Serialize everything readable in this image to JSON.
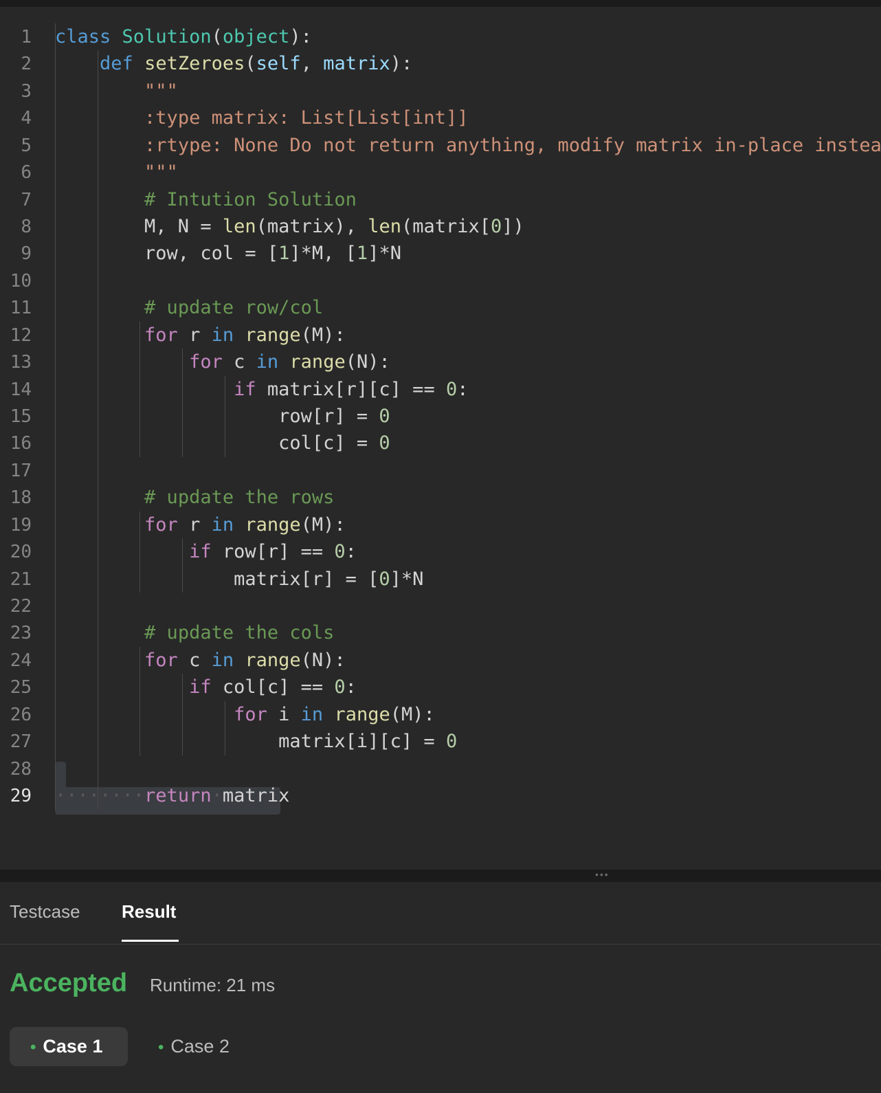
{
  "editor": {
    "lines": [
      {
        "n": "1",
        "tokens": [
          {
            "t": "class",
            "c": "kb"
          },
          {
            "t": " "
          },
          {
            "t": "Solution",
            "c": "cls"
          },
          {
            "t": "("
          },
          {
            "t": "object",
            "c": "cls"
          },
          {
            "t": "):"
          }
        ]
      },
      {
        "n": "2",
        "tokens": [
          {
            "t": "    "
          },
          {
            "t": "def",
            "c": "kb"
          },
          {
            "t": " "
          },
          {
            "t": "setZeroes",
            "c": "fn"
          },
          {
            "t": "("
          },
          {
            "t": "self",
            "c": "prm"
          },
          {
            "t": ", "
          },
          {
            "t": "matrix",
            "c": "prm"
          },
          {
            "t": "):"
          }
        ]
      },
      {
        "n": "3",
        "tokens": [
          {
            "t": "        "
          },
          {
            "t": "\"\"\"",
            "c": "str"
          }
        ]
      },
      {
        "n": "4",
        "tokens": [
          {
            "t": "        "
          },
          {
            "t": ":type matrix: List[List[int]]",
            "c": "str"
          }
        ]
      },
      {
        "n": "5",
        "tokens": [
          {
            "t": "        "
          },
          {
            "t": ":rtype: None Do not return anything, modify matrix in-place instead.",
            "c": "str"
          }
        ]
      },
      {
        "n": "6",
        "tokens": [
          {
            "t": "        "
          },
          {
            "t": "\"\"\"",
            "c": "str"
          }
        ]
      },
      {
        "n": "7",
        "tokens": [
          {
            "t": "        "
          },
          {
            "t": "# Intution Solution",
            "c": "cm"
          }
        ]
      },
      {
        "n": "8",
        "tokens": [
          {
            "t": "        M, N = "
          },
          {
            "t": "len",
            "c": "fn"
          },
          {
            "t": "(matrix), "
          },
          {
            "t": "len",
            "c": "fn"
          },
          {
            "t": "(matrix["
          },
          {
            "t": "0",
            "c": "num"
          },
          {
            "t": "])"
          }
        ]
      },
      {
        "n": "9",
        "tokens": [
          {
            "t": "        row, col = ["
          },
          {
            "t": "1",
            "c": "num"
          },
          {
            "t": "]*M, ["
          },
          {
            "t": "1",
            "c": "num"
          },
          {
            "t": "]*N"
          }
        ]
      },
      {
        "n": "10",
        "tokens": []
      },
      {
        "n": "11",
        "tokens": [
          {
            "t": "        "
          },
          {
            "t": "# update row/col",
            "c": "cm"
          }
        ]
      },
      {
        "n": "12",
        "tokens": [
          {
            "t": "        "
          },
          {
            "t": "for",
            "c": "kw"
          },
          {
            "t": " r "
          },
          {
            "t": "in",
            "c": "kb"
          },
          {
            "t": " "
          },
          {
            "t": "range",
            "c": "fn"
          },
          {
            "t": "(M):"
          }
        ]
      },
      {
        "n": "13",
        "tokens": [
          {
            "t": "            "
          },
          {
            "t": "for",
            "c": "kw"
          },
          {
            "t": " c "
          },
          {
            "t": "in",
            "c": "kb"
          },
          {
            "t": " "
          },
          {
            "t": "range",
            "c": "fn"
          },
          {
            "t": "(N):"
          }
        ]
      },
      {
        "n": "14",
        "tokens": [
          {
            "t": "                "
          },
          {
            "t": "if",
            "c": "kw"
          },
          {
            "t": " matrix[r][c] == "
          },
          {
            "t": "0",
            "c": "num"
          },
          {
            "t": ":"
          }
        ]
      },
      {
        "n": "15",
        "tokens": [
          {
            "t": "                    row[r] = "
          },
          {
            "t": "0",
            "c": "num"
          }
        ]
      },
      {
        "n": "16",
        "tokens": [
          {
            "t": "                    col[c] = "
          },
          {
            "t": "0",
            "c": "num"
          }
        ]
      },
      {
        "n": "17",
        "tokens": []
      },
      {
        "n": "18",
        "tokens": [
          {
            "t": "        "
          },
          {
            "t": "# update the rows",
            "c": "cm"
          }
        ]
      },
      {
        "n": "19",
        "tokens": [
          {
            "t": "        "
          },
          {
            "t": "for",
            "c": "kw"
          },
          {
            "t": " r "
          },
          {
            "t": "in",
            "c": "kb"
          },
          {
            "t": " "
          },
          {
            "t": "range",
            "c": "fn"
          },
          {
            "t": "(M):"
          }
        ]
      },
      {
        "n": "20",
        "tokens": [
          {
            "t": "            "
          },
          {
            "t": "if",
            "c": "kw"
          },
          {
            "t": " row[r] == "
          },
          {
            "t": "0",
            "c": "num"
          },
          {
            "t": ":"
          }
        ]
      },
      {
        "n": "21",
        "tokens": [
          {
            "t": "                matrix[r] = ["
          },
          {
            "t": "0",
            "c": "num"
          },
          {
            "t": "]*N"
          }
        ]
      },
      {
        "n": "22",
        "tokens": []
      },
      {
        "n": "23",
        "tokens": [
          {
            "t": "        "
          },
          {
            "t": "# update the cols",
            "c": "cm"
          }
        ]
      },
      {
        "n": "24",
        "tokens": [
          {
            "t": "        "
          },
          {
            "t": "for",
            "c": "kw"
          },
          {
            "t": " c "
          },
          {
            "t": "in",
            "c": "kb"
          },
          {
            "t": " "
          },
          {
            "t": "range",
            "c": "fn"
          },
          {
            "t": "(N):"
          }
        ]
      },
      {
        "n": "25",
        "tokens": [
          {
            "t": "            "
          },
          {
            "t": "if",
            "c": "kw"
          },
          {
            "t": " col[c] == "
          },
          {
            "t": "0",
            "c": "num"
          },
          {
            "t": ":"
          }
        ]
      },
      {
        "n": "26",
        "tokens": [
          {
            "t": "                "
          },
          {
            "t": "for",
            "c": "kw"
          },
          {
            "t": " i "
          },
          {
            "t": "in",
            "c": "kb"
          },
          {
            "t": " "
          },
          {
            "t": "range",
            "c": "fn"
          },
          {
            "t": "(M):"
          }
        ]
      },
      {
        "n": "27",
        "tokens": [
          {
            "t": "                    matrix[i][c] = "
          },
          {
            "t": "0",
            "c": "num"
          }
        ]
      },
      {
        "n": "28",
        "tokens": []
      },
      {
        "n": "29",
        "active": true,
        "tokens": [
          {
            "t": "········",
            "c": "ws"
          },
          {
            "t": "return",
            "c": "kw"
          },
          {
            "t": "·",
            "c": "ws"
          },
          {
            "t": "matrix"
          }
        ]
      }
    ]
  },
  "panel": {
    "tabs": [
      {
        "label": "Testcase",
        "active": false
      },
      {
        "label": "Result",
        "active": true
      }
    ],
    "status": "Accepted",
    "runtime": "Runtime: 21 ms",
    "cases": [
      {
        "label": "Case 1",
        "active": true
      },
      {
        "label": "Case 2",
        "active": false
      }
    ]
  },
  "colors": {
    "accepted": "#4bb35f",
    "background": "#282828"
  }
}
